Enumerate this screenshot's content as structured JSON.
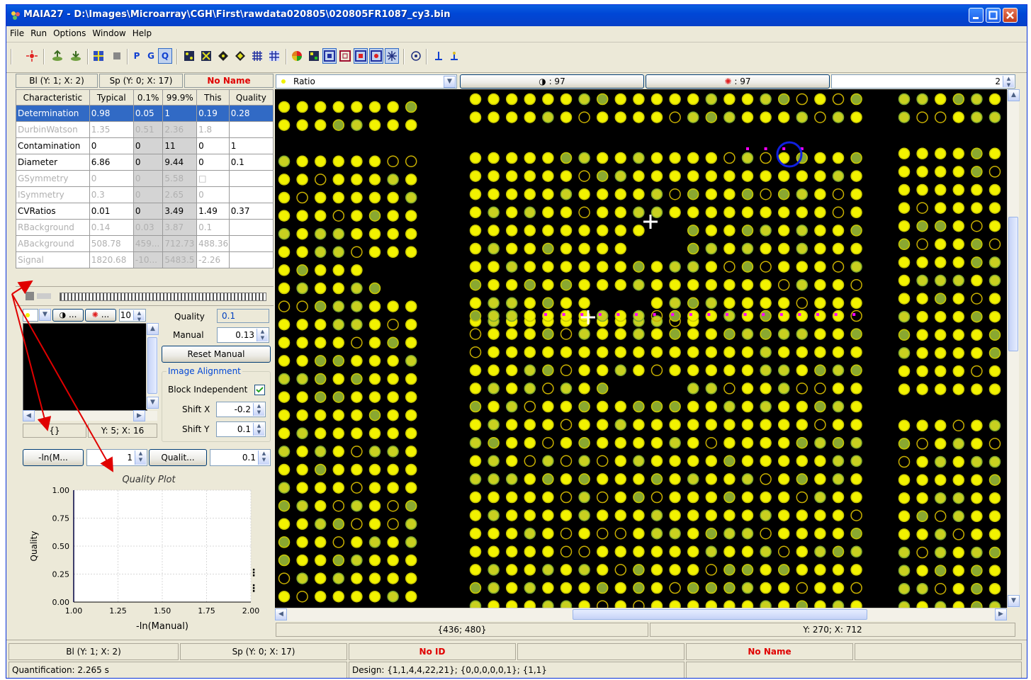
{
  "window": {
    "title": "MAIA27 - D:\\Images\\Microarray\\CGH\\First\\rawdata020805\\020805FR1087_cy3.bin"
  },
  "menu": [
    "File",
    "Run",
    "Options",
    "Window",
    "Help"
  ],
  "toolbar": {
    "p_label": "P",
    "g_label": "G",
    "q_label": "Q"
  },
  "left_header": {
    "block": "Bl (Y: 1; X: 2)",
    "spot": "Sp (Y: 0; X: 17)",
    "name": "No Name"
  },
  "quality_table": {
    "columns": [
      "Characteristic",
      "Typical",
      "0.1%",
      "99.9%",
      "This",
      "Quality"
    ],
    "rows": [
      [
        "Determination",
        "0.98",
        "0.05",
        "1",
        "0.19",
        "0.28"
      ],
      [
        "DurbinWatson",
        "1.35",
        "0.51",
        "2.36",
        "1.8",
        ""
      ],
      [
        "Contamination",
        "0",
        "0",
        "11",
        "0",
        "1"
      ],
      [
        "Diameter",
        "6.86",
        "0",
        "9.44",
        "0",
        "0.1"
      ],
      [
        "GSymmetry",
        "0",
        "0",
        "5.58",
        "□",
        ""
      ],
      [
        "ISymmetry",
        "0.3",
        "0",
        "2.65",
        "0",
        ""
      ],
      [
        "CVRatios",
        "0.01",
        "0",
        "3.49",
        "1.49",
        "0.37"
      ],
      [
        "RBackground",
        "0.14",
        "0.03",
        "3.87",
        "0.1",
        ""
      ],
      [
        "ABackground",
        "508.78",
        "459...",
        "712.73",
        "488.36",
        ""
      ],
      [
        "Signal",
        "1820.68",
        "-10...",
        "5483.5",
        "-2.26",
        ""
      ]
    ]
  },
  "spot_panel": {
    "zoom_value": "10",
    "quality_label": "Quality",
    "quality_value": "0.1",
    "manual_label": "Manual",
    "manual_value": "0.13",
    "reset_label": "Reset Manual",
    "alignment_title": "Image Alignment",
    "block_independent_label": "Block Independent",
    "shift_x_label": "Shift X",
    "shift_x_value": "-0.2",
    "shift_y_label": "Shift Y",
    "shift_y_value": "0.1",
    "brace_text": "{}",
    "coord_text": "Y: 5; X: 16",
    "dropdown_a": "...",
    "dropdown_b": "..."
  },
  "plot_controls": {
    "x_button": "-ln(M...",
    "x_value": "1",
    "y_button": "Qualit...",
    "y_value": "0.1"
  },
  "chart_data": {
    "type": "line",
    "title": "Quality Plot",
    "xlabel": "-ln(Manual)",
    "ylabel": "Quality",
    "xlim": [
      1.0,
      2.0
    ],
    "ylim": [
      0.0,
      1.0
    ],
    "xticks": [
      "1.00",
      "1.25",
      "1.50",
      "1.75",
      "2.00"
    ],
    "yticks": [
      "0.00",
      "0.25",
      "0.50",
      "0.75",
      "1.00"
    ],
    "grid": true,
    "series": [
      {
        "x": [
          1.0,
          1.0
        ],
        "y": [
          0.0,
          1.0
        ],
        "color": "#0000c0"
      }
    ]
  },
  "image_toolbar": {
    "mode": "Ratio",
    "contrast_label": ": 97",
    "bright_label": ": 97",
    "spin_value": "2"
  },
  "image_status": {
    "left": "{436; 480}",
    "right": "Y: 270; X: 712"
  },
  "status_bar": {
    "block": "Bl (Y: 1; X: 2)",
    "spot": "Sp (Y: 0; X: 17)",
    "id": "No ID",
    "name": "No Name",
    "quantification": "Quantification: 2.265 s",
    "design": "Design: {1,1,4,4,22,21}; {0,0,0,0,0,1}; {1,1}"
  },
  "colors": {
    "title_blue": "#0047d6",
    "selection": "#316ac5",
    "alert_red": "#e00000",
    "spot_yellow": "#f2f200",
    "spot_green": "#7fa82a",
    "marker_magenta": "#ff00ff",
    "arrow_red": "#e00000"
  }
}
